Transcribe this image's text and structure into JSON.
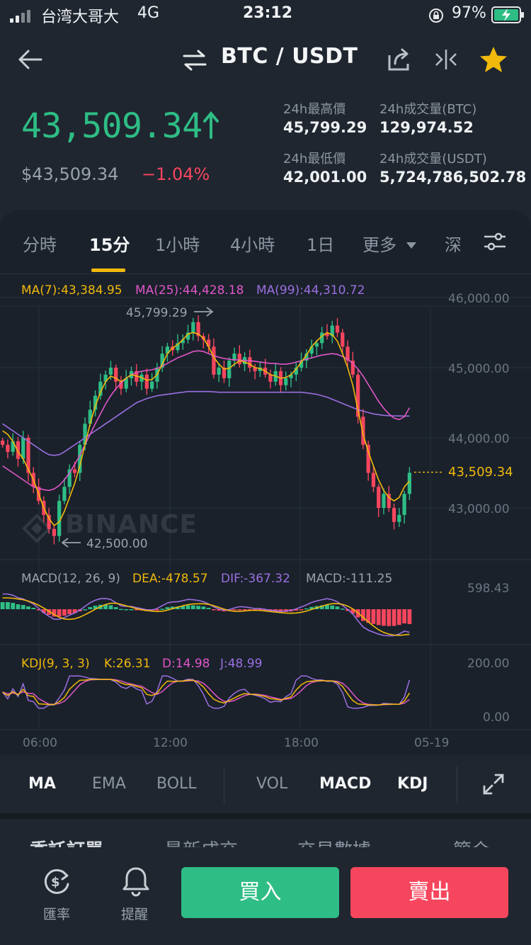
{
  "status_bar": {
    "carrier": "台湾大哥大",
    "network": "4G",
    "time": "23:12",
    "battery": "97%"
  },
  "header": {
    "title": "BTC / USDT",
    "accent": "#f0b90b"
  },
  "ticker": {
    "last_price": "43,509.34",
    "last_price_usd": "$43,509.34",
    "change_pct": "−1.04%",
    "up_color": "#2ebd85",
    "down_color": "#f6465d",
    "stats": {
      "high_label": "24h最高價",
      "high_value": "45,799.29",
      "low_label": "24h最低價",
      "low_value": "42,001.00",
      "vol_btc_label": "24h成交量(BTC)",
      "vol_btc_value": "129,974.52",
      "vol_usdt_label": "24h成交量(USDT)",
      "vol_usdt_value": "5,724,786,502.78"
    }
  },
  "tabs": [
    "分時",
    "15分",
    "1小時",
    "4小時",
    "1日",
    "更多",
    "深"
  ],
  "active_tab": "15分",
  "chart": {
    "ma_legend": {
      "ma7": "MA(7):43,384.95",
      "ma25": "MA(25):44,428.18",
      "ma99": "MA(99):44,310.72"
    },
    "high_marker": "45,799.29",
    "low_marker": "42,500.00",
    "current_price_tag": "43,509.34",
    "watermark": "BINANCE",
    "price_axis": [
      "46,000.00",
      "45,000.00",
      "44,000.00",
      "43,000.00"
    ],
    "macd_legend": {
      "params": "MACD(12, 26, 9)",
      "dea": "DEA:-478.57",
      "dif": "DIF:-367.32",
      "macd": "MACD:-111.25"
    },
    "macd_axis": "598.43",
    "kdj_legend": {
      "params": "KDJ(9, 3, 3)",
      "k": "K:26.31",
      "d": "D:14.98",
      "j": "J:48.99"
    },
    "kdj_axis": [
      "200.00",
      "0.00"
    ],
    "time_axis": [
      "06:00",
      "12:00",
      "18:00",
      "05-19"
    ]
  },
  "chart_data": {
    "type": "candlestick",
    "candles_close": [
      43900,
      43800,
      43950,
      43700,
      44000,
      43500,
      43300,
      43100,
      42900,
      42700,
      42600,
      43100,
      43300,
      43550,
      43500,
      43900,
      44200,
      44400,
      44600,
      44800,
      44900,
      45000,
      44800,
      44700,
      44850,
      44950,
      44800,
      44900,
      44700,
      44800,
      45000,
      45200,
      45300,
      45250,
      45350,
      45400,
      45500,
      45650,
      45450,
      45400,
      45300,
      44900,
      45000,
      44850,
      45100,
      45200,
      45050,
      45150,
      45000,
      44950,
      45000,
      44900,
      44800,
      44950,
      44750,
      44850,
      44900,
      45000,
      45100,
      45200,
      45300,
      45350,
      45500,
      45450,
      45600,
      45500,
      45300,
      45100,
      44900,
      44300,
      43900,
      43500,
      43300,
      43000,
      43200,
      43000,
      42800,
      42900,
      43200,
      43500
    ],
    "ma7": [
      44100,
      44050,
      43950,
      43800,
      43700,
      43550,
      43400,
      43200,
      43000,
      42850,
      42750,
      42800,
      42950,
      43150,
      43350,
      43600,
      43900,
      44200,
      44450,
      44650,
      44800,
      44880,
      44850,
      44800,
      44850,
      44900,
      44880,
      44860,
      44820,
      44830,
      44900,
      45050,
      45200,
      45280,
      45330,
      45400,
      45480,
      45500,
      45480,
      45420,
      45300,
      45150,
      45050,
      44980,
      44990,
      45050,
      45100,
      45080,
      45050,
      45000,
      44990,
      44950,
      44900,
      44880,
      44850,
      44860,
      44900,
      44980,
      45080,
      45180,
      45300,
      45380,
      45450,
      45500,
      45470,
      45380,
      45200,
      45000,
      44750,
      44400,
      44050,
      43800,
      43600,
      43400,
      43250,
      43150,
      43100,
      43150,
      43300,
      43384
    ],
    "ma25": [
      43600,
      43550,
      43500,
      43450,
      43400,
      43350,
      43300,
      43280,
      43260,
      43250,
      43270,
      43320,
      43400,
      43500,
      43620,
      43750,
      43900,
      44050,
      44200,
      44340,
      44480,
      44600,
      44700,
      44780,
      44850,
      44900,
      44930,
      44950,
      44960,
      44970,
      44990,
      45020,
      45060,
      45100,
      45140,
      45170,
      45200,
      45230,
      45240,
      45230,
      45200,
      45170,
      45150,
      45130,
      45120,
      45110,
      45110,
      45100,
      45100,
      45090,
      45080,
      45070,
      45060,
      45060,
      45050,
      45050,
      45060,
      45080,
      45100,
      45120,
      45140,
      45160,
      45180,
      45190,
      45200,
      45190,
      45160,
      45120,
      45060,
      44980,
      44880,
      44760,
      44640,
      44520,
      44420,
      44340,
      44280,
      44260,
      44300,
      44428
    ],
    "ma99": [
      44200,
      44150,
      44100,
      44050,
      44000,
      43950,
      43900,
      43850,
      43800,
      43760,
      43750,
      43760,
      43800,
      43850,
      43900,
      43950,
      44000,
      44050,
      44100,
      44150,
      44200,
      44250,
      44300,
      44350,
      44400,
      44450,
      44500,
      44530,
      44560,
      44580,
      44600,
      44610,
      44620,
      44630,
      44640,
      44650,
      44660,
      44660,
      44660,
      44660,
      44660,
      44655,
      44650,
      44650,
      44650,
      44650,
      44650,
      44650,
      44650,
      44650,
      44650,
      44650,
      44650,
      44650,
      44650,
      44650,
      44650,
      44650,
      44650,
      44640,
      44630,
      44620,
      44600,
      44580,
      44550,
      44520,
      44490,
      44460,
      44430,
      44400,
      44380,
      44360,
      44340,
      44330,
      44320,
      44315,
      44312,
      44311,
      44310,
      44310
    ]
  },
  "indicator_bar": {
    "items": [
      "MA",
      "EMA",
      "BOLL",
      "VOL",
      "MACD",
      "KDJ"
    ],
    "active": [
      "MA",
      "MACD",
      "KDJ"
    ]
  },
  "peek_tabs": [
    "委託訂單",
    "最新成交",
    "交易數據",
    "簡介"
  ],
  "bottom_bar": {
    "exchange_rate": "匯率",
    "alerts": "提醒",
    "buy": "買入",
    "sell": "賣出"
  }
}
